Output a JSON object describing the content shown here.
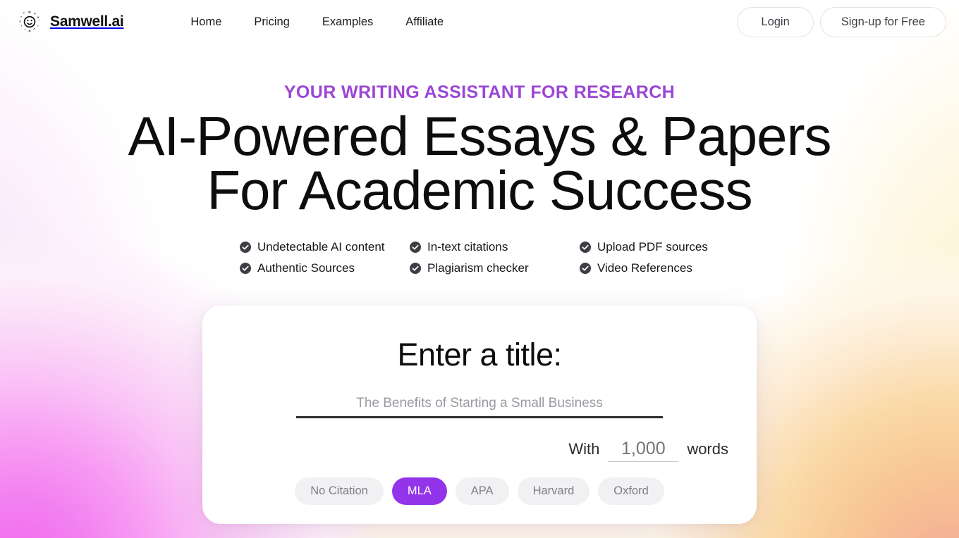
{
  "brand": {
    "name": "Samwell.ai",
    "logo_icon": "smiley-face-logo-icon"
  },
  "nav": {
    "items": [
      {
        "label": "Home"
      },
      {
        "label": "Pricing"
      },
      {
        "label": "Examples"
      },
      {
        "label": "Affiliate"
      }
    ]
  },
  "auth": {
    "login_label": "Login",
    "signup_label": "Sign-up for Free"
  },
  "hero": {
    "eyebrow": "YOUR WRITING ASSISTANT FOR RESEARCH",
    "headline_line1": "AI-Powered Essays & Papers",
    "headline_line2": "For Academic Success"
  },
  "features": [
    {
      "label": "Undetectable AI content",
      "icon": "check-circle-icon"
    },
    {
      "label": "In-text citations",
      "icon": "check-circle-icon"
    },
    {
      "label": "Upload PDF sources",
      "icon": "check-circle-icon"
    },
    {
      "label": "Authentic Sources",
      "icon": "check-circle-icon"
    },
    {
      "label": "Plagiarism checker",
      "icon": "check-circle-icon"
    },
    {
      "label": "Video References",
      "icon": "check-circle-icon"
    }
  ],
  "card": {
    "title": "Enter a title:",
    "title_input": {
      "value": "",
      "placeholder": "The Benefits of Starting a Small Business"
    },
    "words": {
      "prefix": "With",
      "value": "1,000",
      "placeholder": "1,000",
      "suffix": "words"
    },
    "citations": {
      "selected": "MLA",
      "options": [
        {
          "label": "No Citation",
          "selected": false
        },
        {
          "label": "MLA",
          "selected": true
        },
        {
          "label": "APA",
          "selected": false
        },
        {
          "label": "Harvard",
          "selected": false
        },
        {
          "label": "Oxford",
          "selected": false
        }
      ]
    }
  },
  "colors": {
    "accent_purple": "#9333ea",
    "eyebrow_purple": "#9b46d6",
    "text_dark": "#0d0d10",
    "muted_gray": "#9a9aa2",
    "chip_bg": "#f1f1f4",
    "bg_pink": "#f36bec",
    "bg_peach": "#f4a896",
    "bg_yellow": "#fdf1c9"
  }
}
